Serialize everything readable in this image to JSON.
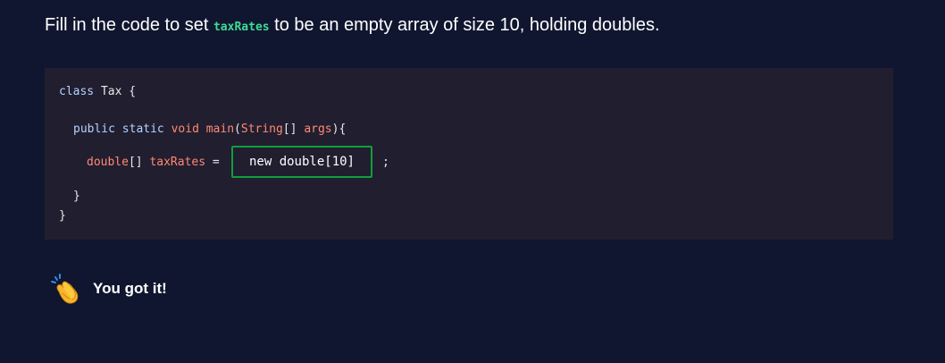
{
  "prompt": {
    "before": "Fill in the code to set ",
    "code": "taxRates",
    "after": " to be an empty array of size 10, holding doubles."
  },
  "code": {
    "line1": {
      "kw": "class",
      "name": " Tax ",
      "brace": "{"
    },
    "line2": {
      "public": "public",
      "static": " static ",
      "void": "void",
      "main": " main",
      "open": "(",
      "type": "String",
      "brackets": "[]",
      "args": " args",
      "close": "){"
    },
    "line3": {
      "type": "double",
      "brackets": "[]",
      "var": " taxRates",
      "eq": " ="
    },
    "semicolon": ";",
    "close_inner": "}",
    "close_outer": "}"
  },
  "answer": {
    "value": "new double[10]"
  },
  "feedback": {
    "icon": "clapping-hands-icon",
    "text": "You got it!"
  }
}
